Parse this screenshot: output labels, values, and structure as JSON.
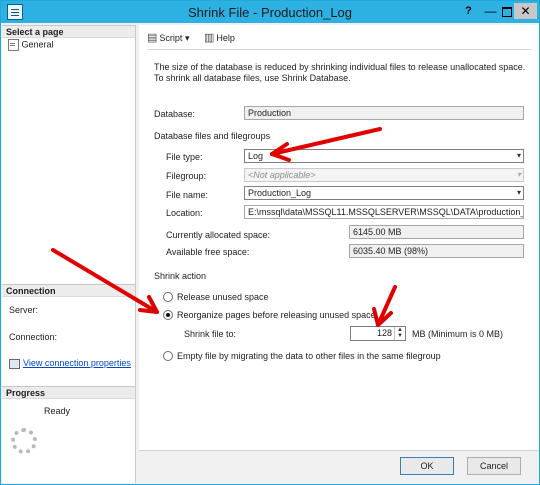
{
  "window": {
    "title": "Shrink File - Production_Log",
    "controls": {
      "help": "?",
      "minimize": "—",
      "close": "✕"
    }
  },
  "sidebar": {
    "select_page_header": "Select a page",
    "pages": [
      {
        "label": "General"
      }
    ],
    "connection_header": "Connection",
    "server_label": "Server:",
    "connection_label": "Connection:",
    "view_connection_link": "View connection properties",
    "progress_header": "Progress",
    "progress_status": "Ready"
  },
  "toolbar": {
    "script_label": "Script",
    "script_dropdown": "▾",
    "help_label": "Help"
  },
  "description": "The size of the database is reduced by shrinking individual files to release unallocated space. To shrink all database files, use Shrink Database.",
  "database": {
    "label": "Database:",
    "value": "Production"
  },
  "files_section": {
    "title": "Database files and filegroups",
    "file_type": {
      "label": "File type:",
      "value": "Log"
    },
    "filegroup": {
      "label": "Filegroup:",
      "value": "<Not applicable>"
    },
    "file_name": {
      "label": "File name:",
      "value": "Production_Log"
    },
    "location": {
      "label": "Location:",
      "value": "E:\\mssql\\data\\MSSQL11.MSSQLSERVER\\MSSQL\\DATA\\production_log.l"
    },
    "allocated": {
      "label": "Currently allocated space:",
      "value": "6145.00 MB"
    },
    "free": {
      "label": "Available free space:",
      "value": "6035.40 MB (98%)"
    }
  },
  "shrink_action": {
    "title": "Shrink action",
    "option_release": "Release unused space",
    "option_reorganize": "Reorganize pages before releasing unused space",
    "shrink_to_label": "Shrink file to:",
    "shrink_to_value": "128",
    "shrink_to_note": "MB (Minimum is 0 MB)",
    "option_empty": "Empty file by migrating the data to other files in the same filegroup",
    "selected": "reorganize"
  },
  "buttons": {
    "ok": "OK",
    "cancel": "Cancel"
  },
  "colors": {
    "titlebar": "#2cb1e2",
    "annotation_arrow": "#e00000",
    "link": "#0046c8"
  },
  "icons": {
    "script": "script-icon",
    "help": "help-book-icon",
    "page": "page-icon",
    "connection": "connection-icon",
    "progress": "spinner-icon"
  }
}
